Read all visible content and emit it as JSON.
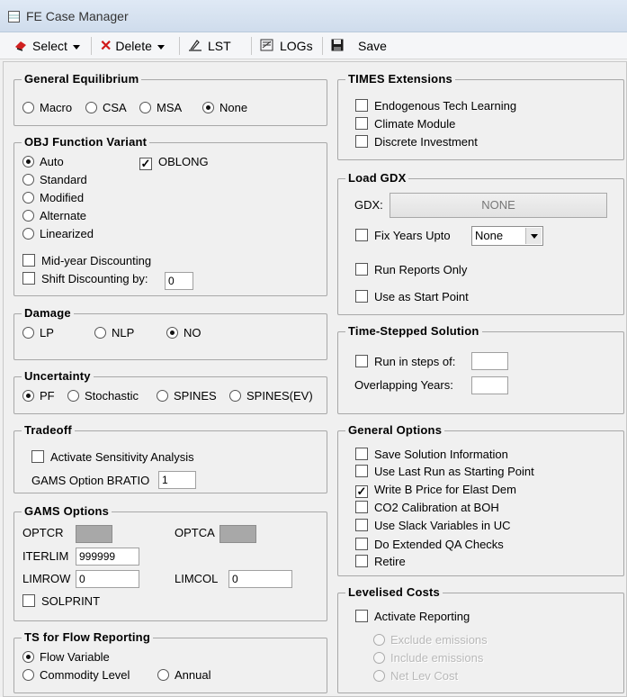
{
  "window": {
    "title": "FE Case Manager"
  },
  "toolbar": {
    "select": "Select",
    "delete": "Delete",
    "lst": "LST",
    "logs": "LOGs",
    "save": "Save"
  },
  "general_equilibrium": {
    "title": "General Equilibrium",
    "options": [
      "Macro",
      "CSA",
      "MSA",
      "None"
    ],
    "selected": "None"
  },
  "obj_function": {
    "title": "OBJ Function Variant",
    "options": [
      "Auto",
      "Standard",
      "Modified",
      "Alternate",
      "Linearized"
    ],
    "selected": "Auto",
    "oblong": {
      "label": "OBLONG",
      "checked": true
    },
    "mid_year": {
      "label": "Mid-year Discounting",
      "checked": false
    },
    "shift": {
      "label": "Shift Discounting by:",
      "checked": false,
      "value": "0"
    }
  },
  "damage": {
    "title": "Damage",
    "options": [
      "LP",
      "NLP",
      "NO"
    ],
    "selected": "NO"
  },
  "uncertainty": {
    "title": "Uncertainty",
    "options": [
      "PF",
      "Stochastic",
      "SPINES",
      "SPINES(EV)"
    ],
    "selected": "PF"
  },
  "tradeoff": {
    "title": "Tradeoff",
    "sensitivity": {
      "label": "Activate Sensitivity Analysis",
      "checked": false
    },
    "bratio_label": "GAMS Option BRATIO",
    "bratio_value": "1"
  },
  "gams_options": {
    "title": "GAMS Options",
    "optcr_label": "OPTCR",
    "optca_label": "OPTCA",
    "iterlim_label": "ITERLIM",
    "iterlim_value": "999999",
    "limrow_label": "LIMROW",
    "limrow_value": "0",
    "limcol_label": "LIMCOL",
    "limcol_value": "0",
    "solprint": {
      "label": "SOLPRINT",
      "checked": false
    }
  },
  "ts_flow": {
    "title": "TS for Flow Reporting",
    "options": [
      "Flow Variable",
      "Commodity Level",
      "Annual"
    ],
    "selected": "Flow Variable"
  },
  "times_extensions": {
    "title": "TIMES Extensions",
    "items": [
      {
        "label": "Endogenous Tech Learning",
        "checked": false
      },
      {
        "label": "Climate Module",
        "checked": false
      },
      {
        "label": "Discrete Investment",
        "checked": false
      }
    ]
  },
  "load_gdx": {
    "title": "Load GDX",
    "gdx_label": "GDX:",
    "gdx_button": "NONE",
    "fix_years": {
      "label": "Fix Years Upto",
      "checked": false,
      "value": "None"
    },
    "run_reports": {
      "label": "Run Reports Only",
      "checked": false
    },
    "start_point": {
      "label": "Use as Start Point",
      "checked": false
    }
  },
  "time_stepped": {
    "title": "Time-Stepped Solution",
    "run_steps": {
      "label": "Run in steps of:",
      "checked": false,
      "value": ""
    },
    "overlap_label": "Overlapping Years:",
    "overlap_value": ""
  },
  "general_options": {
    "title": "General Options",
    "items": [
      {
        "label": "Save Solution Information",
        "checked": false
      },
      {
        "label": "Use Last Run as Starting Point",
        "checked": false
      },
      {
        "label": "Write B Price for Elast Dem",
        "checked": true
      },
      {
        "label": "CO2 Calibration at BOH",
        "checked": false
      },
      {
        "label": "Use Slack Variables in UC",
        "checked": false
      },
      {
        "label": "Do Extended QA Checks",
        "checked": false
      },
      {
        "label": "Retire",
        "checked": false
      }
    ]
  },
  "levelised": {
    "title": "Levelised Costs",
    "activate": {
      "label": "Activate Reporting",
      "checked": false
    },
    "options": [
      "Exclude emissions",
      "Include emissions",
      "Net Lev Cost"
    ]
  }
}
